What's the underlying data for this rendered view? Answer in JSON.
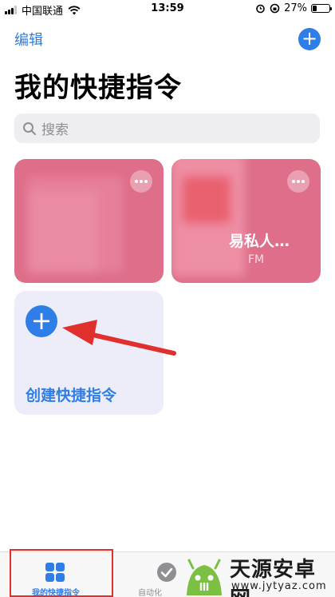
{
  "status_bar": {
    "carrier": "中国联通",
    "time": "13:59",
    "battery": "27%",
    "battery_level": 0.27
  },
  "nav": {
    "edit_label": "编辑",
    "add_icon": "plus-icon"
  },
  "page_title": "我的快捷指令",
  "search": {
    "placeholder": "搜索"
  },
  "shortcuts": [
    {
      "title": "",
      "subtitle": "",
      "color": "#de6e8a"
    },
    {
      "title": "易私人…",
      "subtitle": "FM",
      "color": "#de6e8a"
    }
  ],
  "create_card": {
    "label": "创建快捷指令"
  },
  "tab_bar": {
    "tabs": [
      {
        "label": "我的快捷指令",
        "icon": "grid-icon",
        "active": true
      },
      {
        "label": "自动化",
        "icon": "check-circle-icon",
        "active": false
      }
    ]
  },
  "watermark": {
    "name": "天源安卓网",
    "url": "www.jytyaz.com"
  },
  "colors": {
    "accent": "#2f7ee8",
    "card_pink": "#de6e8a",
    "annotation_red": "#e0302e"
  }
}
